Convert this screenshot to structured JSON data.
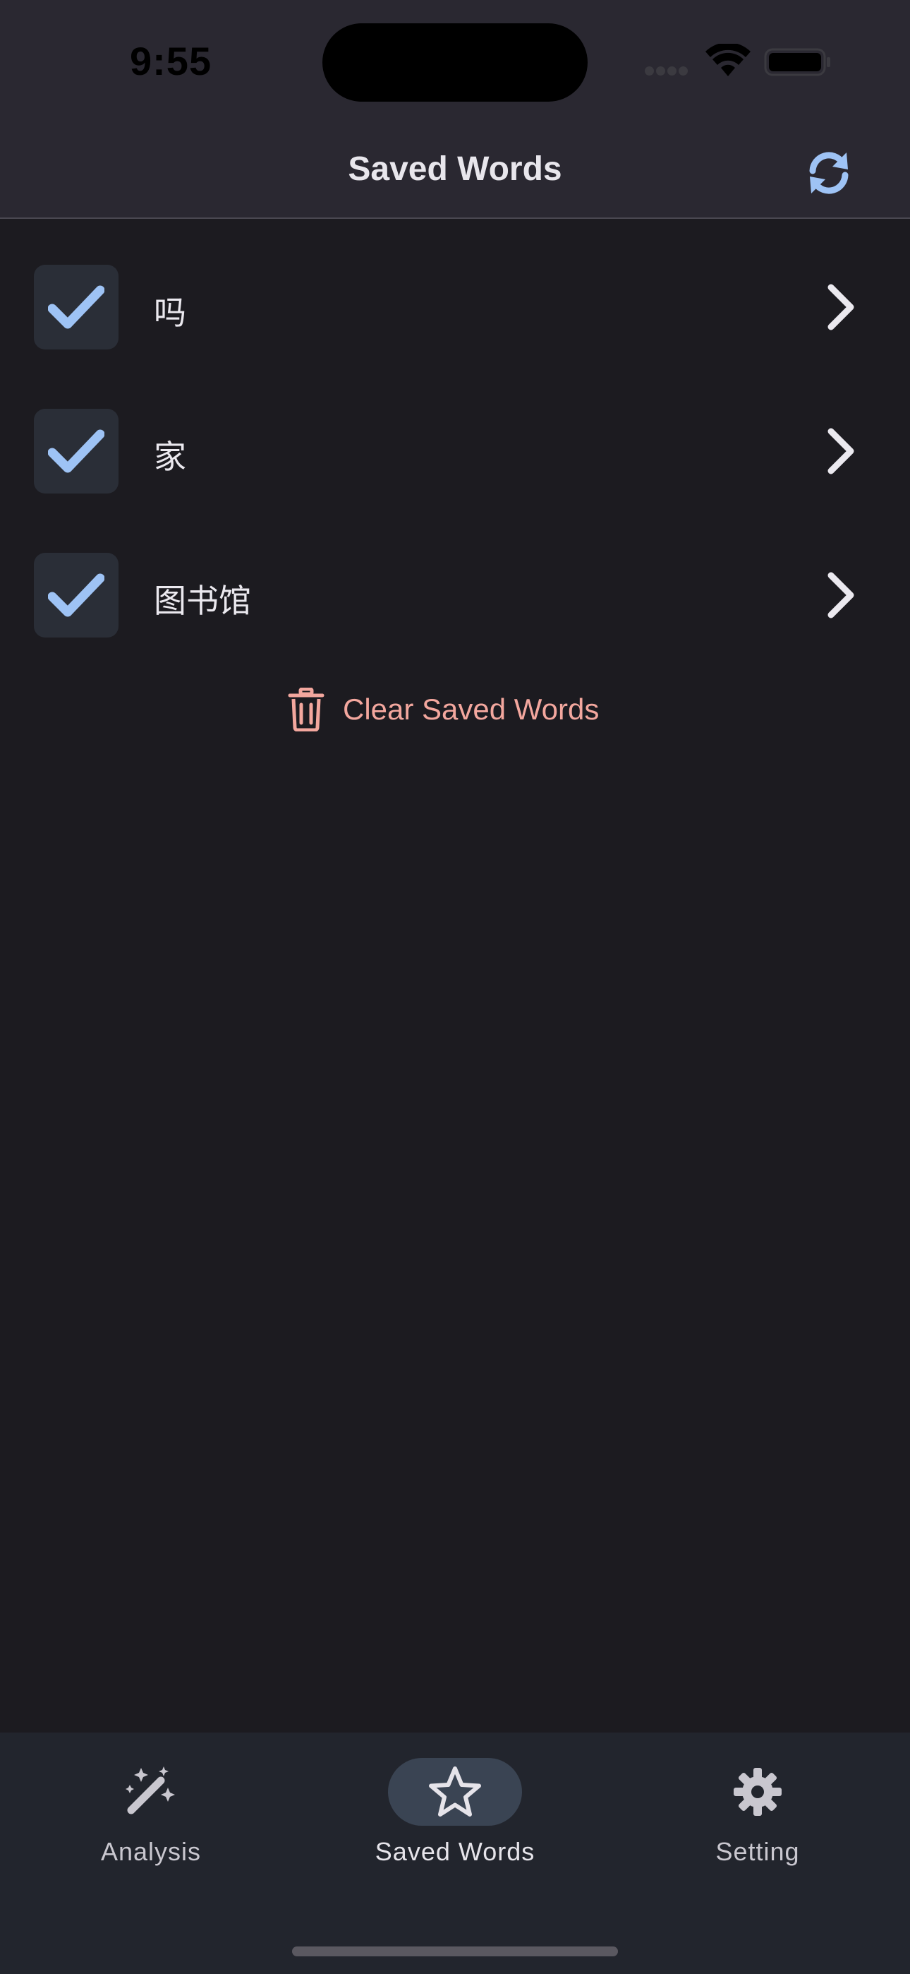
{
  "status_bar": {
    "time": "9:55"
  },
  "header": {
    "title": "Saved Words",
    "refresh_icon": "refresh-icon"
  },
  "words": [
    {
      "text": "吗",
      "checked": true
    },
    {
      "text": "家",
      "checked": true
    },
    {
      "text": "图书馆",
      "checked": true
    }
  ],
  "clear_button": {
    "label": "Clear Saved Words",
    "icon": "trash-icon",
    "color": "#f3a79e"
  },
  "bottom_nav": {
    "items": [
      {
        "label": "Analysis",
        "icon": "magic-wand-icon",
        "active": false
      },
      {
        "label": "Saved Words",
        "icon": "star-icon",
        "active": true
      },
      {
        "label": "Setting",
        "icon": "gear-icon",
        "active": false
      }
    ]
  },
  "colors": {
    "background": "#1c1b20",
    "header_bg": "#2a2831",
    "accent": "#9ec3f5",
    "danger": "#f3a79e",
    "nav_bg": "#22252d"
  }
}
